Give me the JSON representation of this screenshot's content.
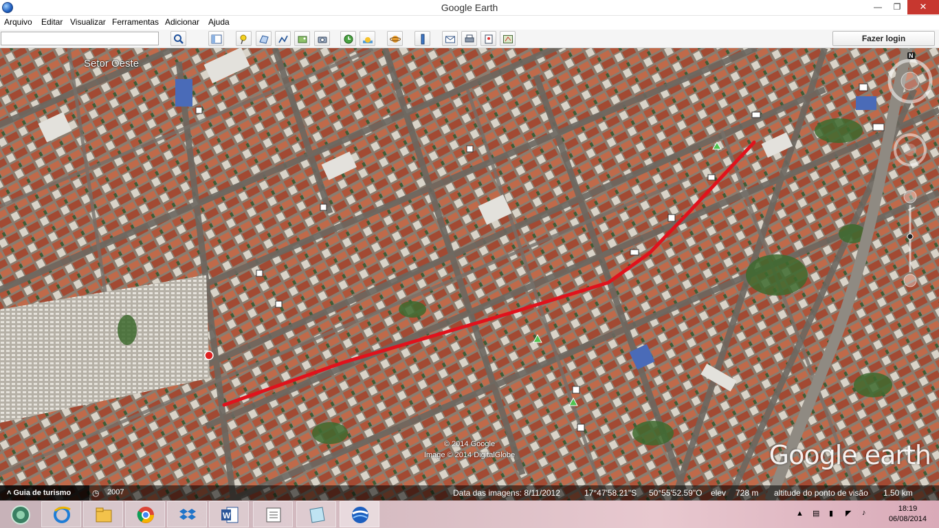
{
  "window": {
    "title": "Google Earth"
  },
  "menu": [
    "Arquivo",
    "Editar",
    "Visualizar",
    "Ferramentas",
    "Adicionar",
    "Ajuda"
  ],
  "toolbar": {
    "search_value": "",
    "login_label": "Fazer login"
  },
  "map": {
    "place_label": "Setor Oeste",
    "copyright_line1": "© 2014 Google",
    "copyright_line2": "Image © 2014 DigitalGlobe",
    "logo": "Google earth",
    "compass_letter": "N",
    "route_color": "#e0121c"
  },
  "status": {
    "tour_label": "Guia de turismo",
    "year": "2007",
    "imagery_date": "Data das imagens: 8/11/2012",
    "latitude": "17°47'58.21\"S",
    "longitude": "50°55'52.59\"O",
    "elev_label": "elev",
    "elev_value": "728 m",
    "eye_alt_label": "altitude do ponto de visão",
    "eye_alt_value": "1.50 km"
  },
  "taskbar": {
    "apps": [
      "start-orb-icon",
      "internet-explorer-icon",
      "file-explorer-icon",
      "chrome-icon",
      "dropbox-icon",
      "word-icon",
      "notes-icon",
      "sticky-icon",
      "google-earth-icon"
    ],
    "time": "18:19",
    "date": "06/08/2014"
  }
}
